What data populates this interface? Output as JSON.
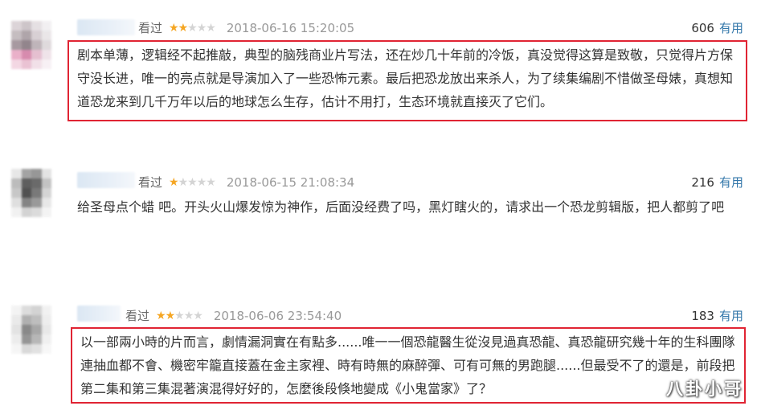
{
  "reviews": [
    {
      "status": "看过",
      "stars": 2,
      "date": "2018-06-16 15:20:05",
      "votes": "606",
      "useful_label": "有用",
      "boxed": true,
      "text": "剧本单薄，逻辑经不起推敲，典型的脑残商业片写法，还在炒几十年前的冷饭，真没觉得这算是致敬，只觉得片方保守没长进，唯一的亮点就是导演加入了一些恐怖元素。最后把恐龙放出来杀人，为了续集编剧不惜做圣母婊，真想知道恐龙来到几千万年以后的地球怎么生存，估计不用打，生态环境就直接灭了它们。"
    },
    {
      "status": "看过",
      "stars": 1,
      "date": "2018-06-15 21:08:34",
      "votes": "216",
      "useful_label": "有用",
      "boxed": false,
      "text": "给圣母点个蜡  吧。开头火山爆发惊为神作，后面没经费了吗，黑灯瞎火的，请求出一个恐龙剪辑版，把人都剪了吧"
    },
    {
      "status": "看过",
      "stars": 2,
      "date": "2018-06-06 23:54:40",
      "votes": "183",
      "useful_label": "有用",
      "boxed": true,
      "text": "以一部兩小時的片而言，劇情漏洞實在有點多......唯一一個恐龍醫生從沒見過真恐龍、真恐龍研究幾十年的生科團隊連抽血都不會、機密牢籠直接蓋在金主家裡、時有時無的麻醉彈、可有可無的男跑腿......但最受不了的還是，前段把第二集和第三集混著演混得好好的，怎麼後段倏地變成《小鬼當家》了？"
    }
  ],
  "watermark": "八卦小哥",
  "colors": {
    "star": "#f5a623",
    "useful": "#3377aa",
    "highlight_box": "#e02433"
  }
}
